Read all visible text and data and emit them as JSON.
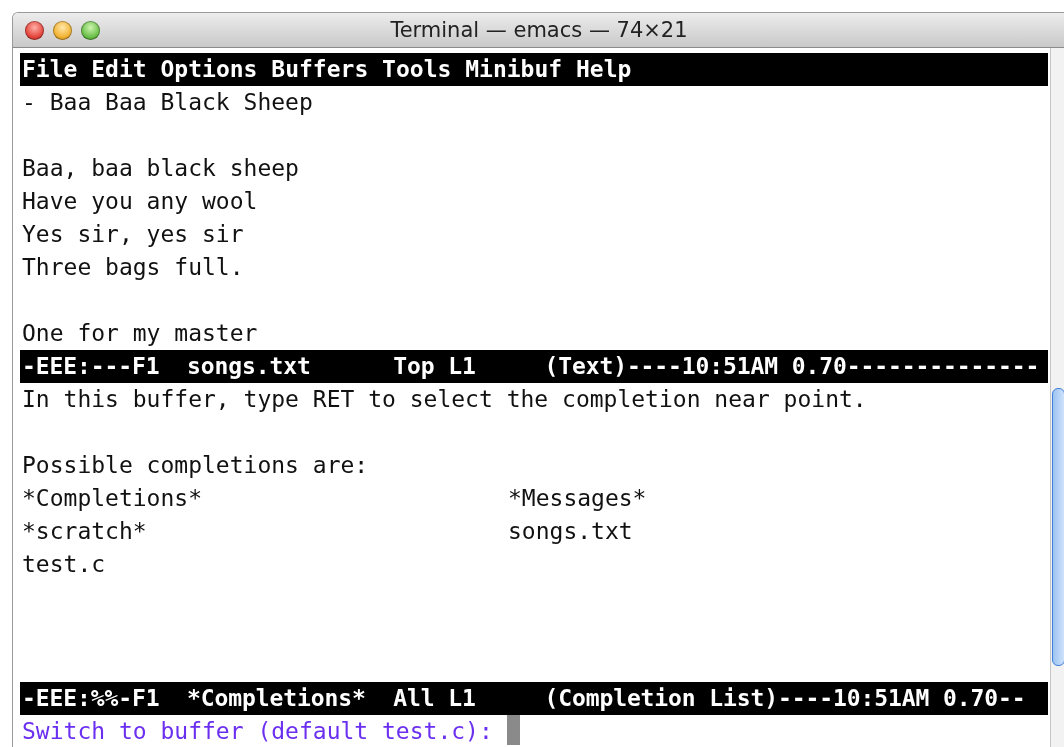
{
  "window": {
    "title": "Terminal — emacs — 74×21"
  },
  "menu_bar": [
    "File",
    "Edit",
    "Options",
    "Buffers",
    "Tools",
    "Minibuf",
    "Help"
  ],
  "buffer": {
    "title_line": "- Baa Baa Black Sheep",
    "stanzas": [
      [
        "Baa, baa black sheep",
        "Have you any wool",
        "Yes sir, yes sir",
        "Three bags full."
      ],
      [
        "One for my master"
      ]
    ]
  },
  "mode_lines": [
    "-EEE:---F1  songs.txt      Top L1     (Text)----10:51AM 0.70--------------",
    "-EEE:%%-F1  *Completions*  All L1     (Completion List)----10:51AM 0.70--"
  ],
  "completions": {
    "hint": "In this buffer, type RET to select the completion near point.",
    "header": "Possible completions are:",
    "items": [
      "*Completions*",
      "*Messages*",
      "*scratch*",
      "songs.txt",
      "test.c"
    ]
  },
  "minibuffer": {
    "prompt": "Switch to buffer (default test.c):"
  }
}
